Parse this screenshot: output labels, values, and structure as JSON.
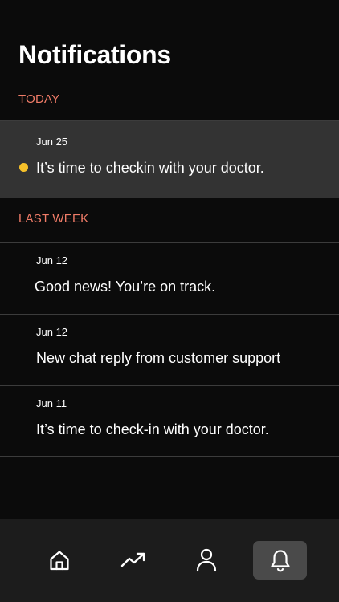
{
  "header": {
    "title": "Notifications"
  },
  "sections": [
    {
      "label": "TODAY",
      "items": [
        {
          "date": "Jun 25",
          "text": "It’s time to checkin with your doctor.",
          "unread": true
        }
      ]
    },
    {
      "label": "LAST WEEK",
      "items": [
        {
          "date": "Jun 12",
          "text": "Good news! You’re on track.",
          "unread": false
        },
        {
          "date": "Jun 12",
          "text": "New chat reply from customer support",
          "unread": false
        },
        {
          "date": "Jun 11",
          "text": "It’s time to check-in with your doctor.",
          "unread": false
        }
      ]
    }
  ],
  "tabbar": {
    "tabs": [
      {
        "icon": "home-icon",
        "selected": false
      },
      {
        "icon": "trending-up-icon",
        "selected": false
      },
      {
        "icon": "profile-icon",
        "selected": false
      },
      {
        "icon": "bell-icon",
        "selected": true
      }
    ]
  },
  "colors": {
    "background": "#0b0b0b",
    "accent_section": "#f07c68",
    "unread_dot": "#f6c12a",
    "active_row": "#333333",
    "tabbar": "#1c1c1c",
    "selected_tab": "#4a4a4a"
  }
}
